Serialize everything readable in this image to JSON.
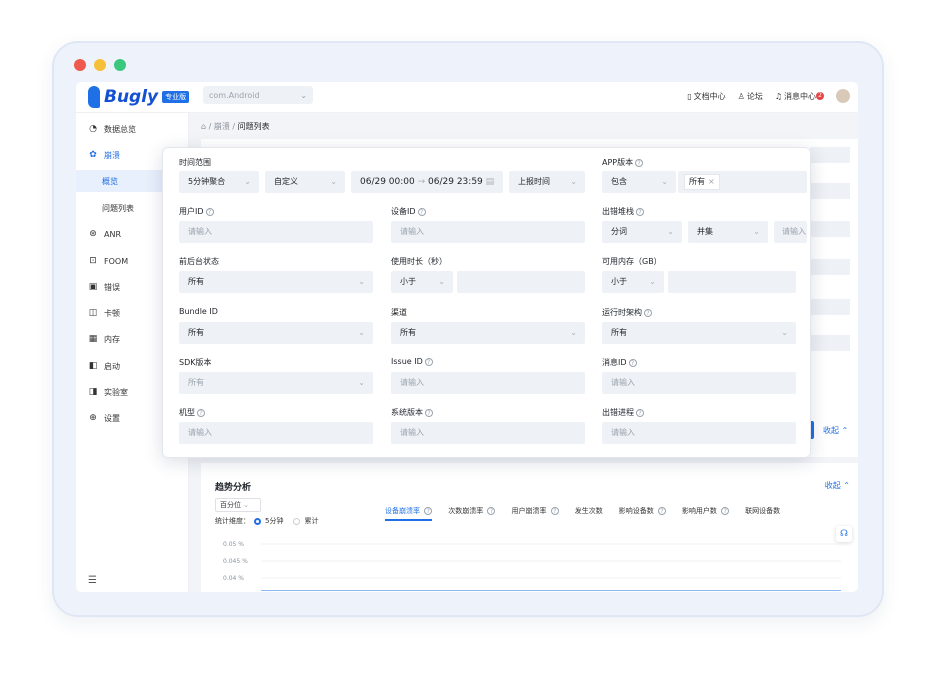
{
  "app": {
    "brand": "Bugly",
    "edition_badge": "专业版",
    "app_selector": "com.Android"
  },
  "topnav": {
    "docs": "文档中心",
    "forum": "论坛",
    "messages": "消息中心",
    "message_count": "2"
  },
  "sidebar": {
    "items": [
      {
        "label": "数据总览",
        "icon": "dashboard-icon"
      },
      {
        "label": "崩溃",
        "icon": "crash-icon"
      },
      {
        "label": "概览"
      },
      {
        "label": "问题列表"
      },
      {
        "label": "ANR",
        "icon": "anr-icon"
      },
      {
        "label": "FOOM",
        "icon": "foom-icon"
      },
      {
        "label": "错误",
        "icon": "error-icon"
      },
      {
        "label": "卡顿",
        "icon": "lag-icon"
      },
      {
        "label": "内存",
        "icon": "memory-icon"
      },
      {
        "label": "启动",
        "icon": "launch-icon"
      },
      {
        "label": "实验室",
        "icon": "lab-icon"
      },
      {
        "label": "设置",
        "icon": "settings-icon"
      }
    ]
  },
  "breadcrumb": {
    "sep": "/",
    "level1": "崩溃",
    "level2": "问题列表"
  },
  "filter": {
    "time_range": {
      "label": "时间范围",
      "aggregation": "5分钟聚合",
      "mode": "自定义",
      "start": "06/29 00:00",
      "end": "06/29 23:59",
      "time_type": "上报时间"
    },
    "app_version": {
      "label": "APP版本",
      "op": "包含",
      "tag": "所有"
    },
    "user_id": {
      "label": "用户ID",
      "placeholder": "请输入"
    },
    "device_id": {
      "label": "设备ID",
      "placeholder": "请输入"
    },
    "stack": {
      "label": "出错堆栈",
      "split": "分词",
      "join": "并集",
      "placeholder": "请输入"
    },
    "fg_bg": {
      "label": "前后台状态",
      "value": "所有"
    },
    "duration": {
      "label": "使用时长（秒）",
      "op": "小于"
    },
    "memory": {
      "label": "可用内存（GB）",
      "op": "小于"
    },
    "bundle": {
      "label": "Bundle ID",
      "value": "所有"
    },
    "channel": {
      "label": "渠道",
      "value": "所有"
    },
    "arch": {
      "label": "运行时架构",
      "value": "所有"
    },
    "sdk": {
      "label": "SDK版本",
      "value": "所有"
    },
    "issue_id": {
      "label": "Issue ID",
      "placeholder": "请输入"
    },
    "msg_id": {
      "label": "消息ID",
      "placeholder": "请输入"
    },
    "model": {
      "label": "机型",
      "placeholder": "请输入"
    },
    "os_version": {
      "label": "系统版本",
      "placeholder": "请输入"
    },
    "process": {
      "label": "出错进程",
      "placeholder": "请输入"
    }
  },
  "collapse_label": "收起",
  "trend": {
    "title": "趋势分析",
    "collapse": "收起",
    "percentile": "百分位",
    "dim_label": "统计维度：",
    "dim_opt1": "5分钟",
    "dim_opt2": "累计",
    "tabs": [
      "设备崩溃率",
      "次数崩溃率",
      "用户崩溃率",
      "发生次数",
      "影响设备数",
      "影响用户数",
      "联网设备数"
    ],
    "y_ticks": [
      "0.05 %",
      "0.045 %",
      "0.04 %"
    ]
  },
  "chart_data": {
    "type": "line",
    "series": [
      {
        "values": [
          0,
          0,
          0,
          0,
          0,
          0,
          0,
          0,
          0,
          0,
          0,
          0,
          0,
          0,
          0,
          0,
          0,
          0,
          0,
          0,
          0,
          0,
          0,
          0,
          0,
          0,
          0,
          0,
          0,
          0,
          0,
          0,
          0,
          0,
          0,
          0,
          0,
          0,
          0,
          0,
          0,
          0,
          0,
          0,
          0,
          0,
          0,
          0,
          0,
          0,
          0,
          0,
          0,
          0,
          0,
          0,
          0,
          0,
          0,
          0,
          0,
          0,
          0,
          0,
          0,
          0,
          0,
          0,
          0,
          0,
          0,
          0,
          0,
          0,
          0,
          0,
          0,
          0,
          0,
          0,
          0,
          0,
          0,
          0,
          0,
          0,
          0,
          0,
          0,
          0,
          0,
          0,
          0,
          0,
          0,
          0,
          0,
          0,
          0,
          0
        ]
      }
    ],
    "ylim": [
      0,
      0.05
    ],
    "y_ticks": [
      "0.05 %",
      "0.045 %",
      "0.04 %"
    ]
  },
  "colors": {
    "accent": "#1f6fe6",
    "dot_red": "#ee5a4d",
    "dot_yellow": "#f5bf3a",
    "dot_green": "#3cc77f"
  }
}
